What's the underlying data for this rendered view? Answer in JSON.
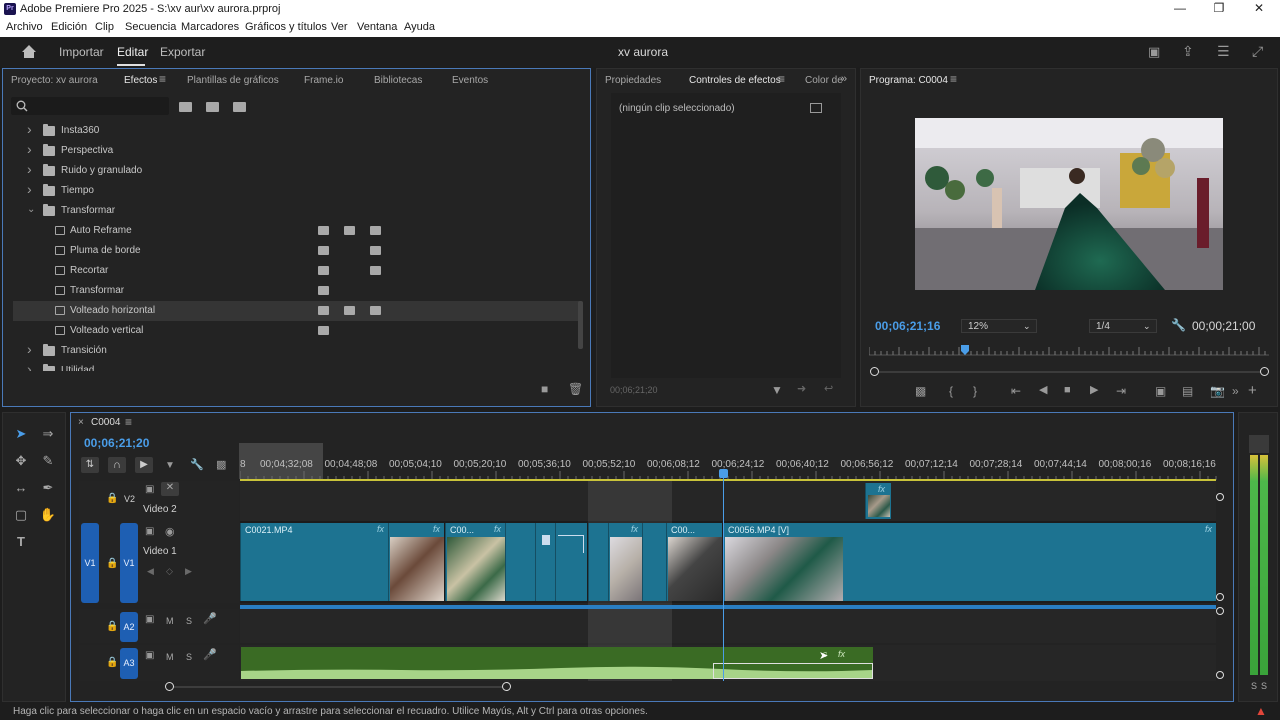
{
  "window": {
    "title": "Adobe Premiere Pro 2025 - S:\\xv aur\\xv aurora.prproj",
    "logo_text": "Pr"
  },
  "menu": [
    "Archivo",
    "Edición",
    "Clip",
    "Secuencia",
    "Marcadores",
    "Gráficos y títulos",
    "Ver",
    "Ventana",
    "Ayuda"
  ],
  "workspace": {
    "tabs": [
      "Importar",
      "Editar",
      "Exportar"
    ],
    "active": "Editar",
    "project_name": "xv aurora"
  },
  "left_panel": {
    "tabs": [
      "Proyecto: xv aurora",
      "Efectos",
      "Plantillas de gráficos",
      "Frame.io",
      "Bibliotecas",
      "Eventos"
    ],
    "active_tab": "Efectos",
    "search_placeholder": "",
    "tree": [
      {
        "label": "Insta360",
        "type": "folder",
        "expanded": false
      },
      {
        "label": "Perspectiva",
        "type": "folder",
        "expanded": false
      },
      {
        "label": "Ruido y granulado",
        "type": "folder",
        "expanded": false
      },
      {
        "label": "Tiempo",
        "type": "folder",
        "expanded": false
      },
      {
        "label": "Transformar",
        "type": "folder",
        "expanded": true
      },
      {
        "label": "Auto Reframe",
        "type": "effect",
        "badges": [
          1,
          1,
          1
        ]
      },
      {
        "label": "Pluma de borde",
        "type": "effect",
        "badges": [
          1,
          0,
          1
        ]
      },
      {
        "label": "Recortar",
        "type": "effect",
        "badges": [
          1,
          0,
          1
        ]
      },
      {
        "label": "Transformar",
        "type": "effect",
        "badges": [
          1,
          0,
          0
        ]
      },
      {
        "label": "Volteado horizontal",
        "type": "effect",
        "badges": [
          1,
          1,
          1
        ],
        "selected": true
      },
      {
        "label": "Volteado vertical",
        "type": "effect",
        "badges": [
          1,
          0,
          0
        ]
      },
      {
        "label": "Transición",
        "type": "folder",
        "expanded": false
      },
      {
        "label": "Utilidad",
        "type": "folder",
        "expanded": false
      }
    ]
  },
  "mid_panel": {
    "tabs": [
      "Propiedades",
      "Controles de efectos",
      "Color de"
    ],
    "active_tab": "Controles de efectos",
    "empty_text": "(ningún clip seleccionado)",
    "timecode": "00;06;21;20"
  },
  "program": {
    "title": "Programa: C0004",
    "timecode": "00;06;21;16",
    "zoom": "12%",
    "resolution": "1/4",
    "duration": "00;00;21;00"
  },
  "timeline": {
    "sequence": "C0004",
    "timecode": "00;06;21;20",
    "ruler": [
      "8",
      "00;04;32;08",
      "00;04;48;08",
      "00;05;04;10",
      "00;05;20;10",
      "00;05;36;10",
      "00;05;52;10",
      "00;06;08;12",
      "00;06;24;12",
      "00;06;40;12",
      "00;06;56;12",
      "00;07;12;14",
      "00;07;28;14",
      "00;07;44;14",
      "00;08;00;16",
      "00;08;16;16"
    ],
    "tracks": {
      "v2": {
        "id": "V2",
        "name": "Video 2"
      },
      "v1": {
        "id": "V1",
        "name": "Video 1",
        "src": "V1"
      },
      "a2": {
        "id": "A2",
        "m": "M",
        "s": "S"
      },
      "a3": {
        "id": "A3",
        "m": "M",
        "s": "S"
      }
    },
    "clips": [
      "C0021.MP4",
      "C00...",
      "C00...",
      "C0056.MP4 [V]"
    ],
    "fx_label": "fx"
  },
  "meter": {
    "labels": [
      "S",
      "S"
    ]
  },
  "status": "Haga clic para seleccionar o haga clic en un espacio vacío y arrastre para seleccionar el recuadro. Utilice Mayús, Alt y Ctrl para otras opciones.",
  "colors": {
    "accent": "#1e5fb3",
    "clip": "#1d7391",
    "audio": "#3a6b24",
    "timecode": "#4a9de8"
  }
}
